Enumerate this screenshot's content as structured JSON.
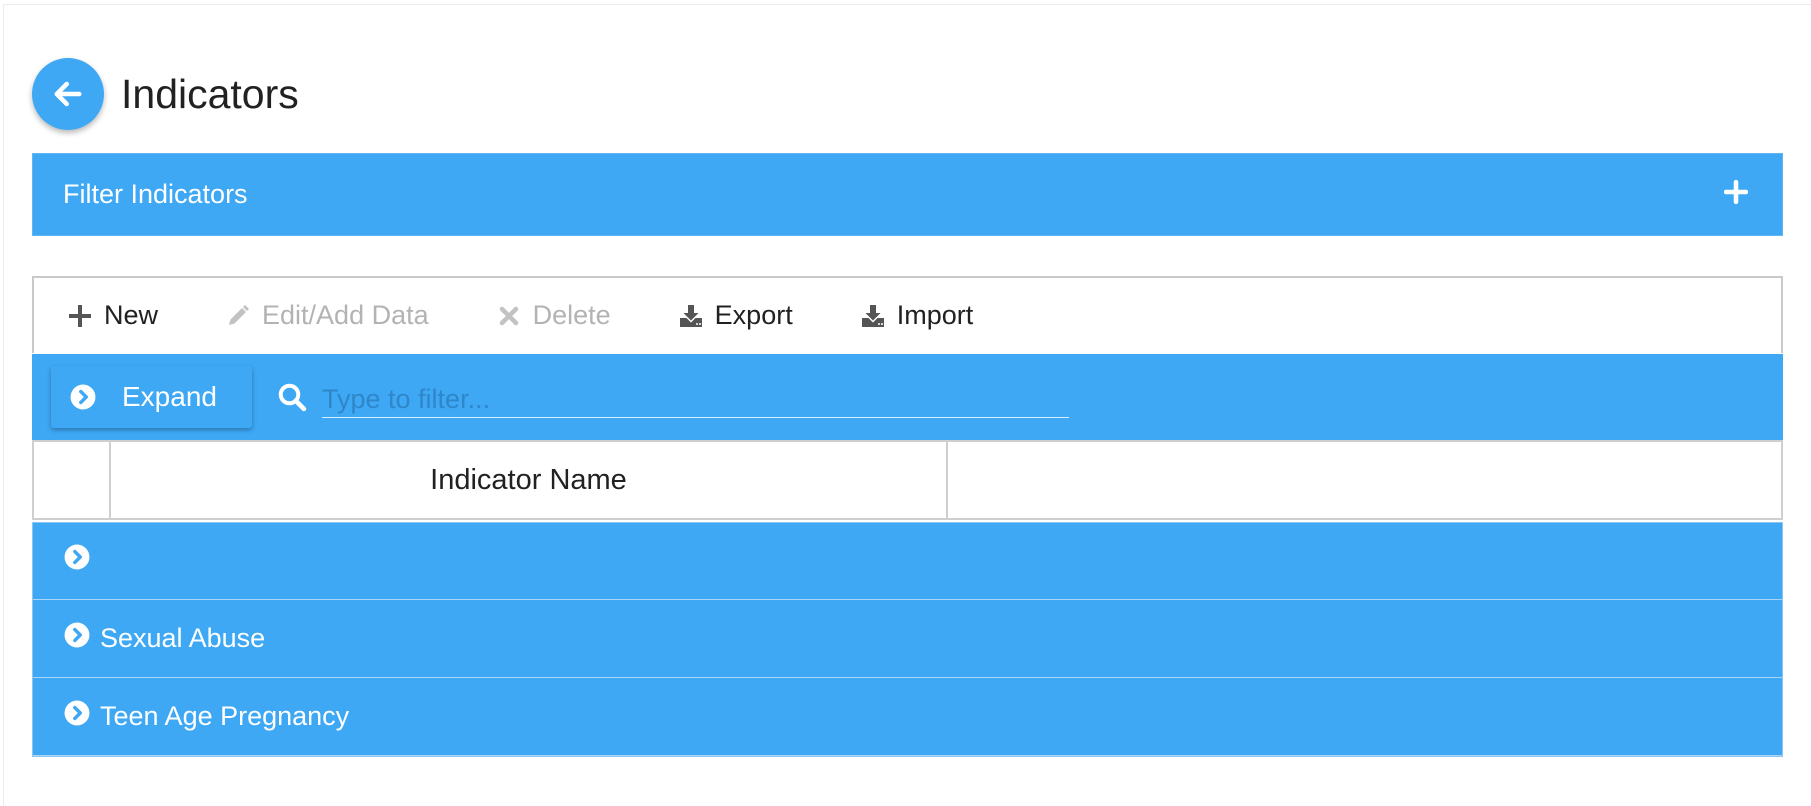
{
  "header": {
    "title": "Indicators",
    "back_icon": "arrow-left-icon"
  },
  "filter_panel": {
    "title": "Filter Indicators",
    "toggle_icon": "plus-icon"
  },
  "toolbar": {
    "items": [
      {
        "label": "New",
        "icon": "plus-icon",
        "enabled": true
      },
      {
        "label": "Edit/Add Data",
        "icon": "pencil-icon",
        "enabled": false
      },
      {
        "label": "Delete",
        "icon": "x-icon",
        "enabled": false
      },
      {
        "label": "Export",
        "icon": "download-icon",
        "enabled": true
      },
      {
        "label": "Import",
        "icon": "download-icon",
        "enabled": true
      }
    ]
  },
  "grid": {
    "expand_label": "Expand",
    "search_placeholder": "Type to filter...",
    "search_value": "",
    "columns": [
      "",
      "Indicator Name",
      ""
    ],
    "groups": [
      {
        "label": ""
      },
      {
        "label": "Sexual Abuse"
      },
      {
        "label": "Teen Age Pregnancy"
      }
    ]
  },
  "colors": {
    "accent": "#3ea8f5",
    "disabled_text": "#b3b3b3",
    "border": "#c9c9c9"
  }
}
